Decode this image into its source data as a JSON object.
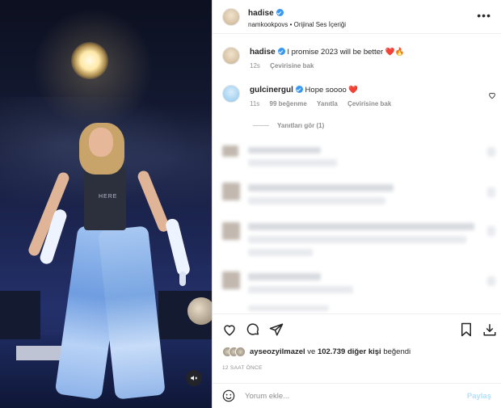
{
  "post": {
    "author": "hadise",
    "subtitle": "namkookpovs • Orijinal Ses İçeriği",
    "more_label": "•••"
  },
  "caption": {
    "author": "hadise",
    "text": "I promise 2023 will be better",
    "emoji": "❤️🔥",
    "time": "12s",
    "translate": "Çevirisine bak"
  },
  "top_comment": {
    "author": "gulcinergul",
    "text": "Hope soooo",
    "emoji": "❤️",
    "time": "11s",
    "likes": "99 beğenme",
    "reply": "Yanıtla",
    "translate": "Çevirisine bak"
  },
  "view_replies": "Yanıtları gör (1)",
  "likes": {
    "first_user": "ayseozyilmazel",
    "conjunction": "ve",
    "count": "102.739",
    "suffix_strong": "diğer kişi",
    "suffix": "beğendi"
  },
  "timestamp": "12 SAAT ÖNCE",
  "comment_box": {
    "placeholder": "Yorum ekle...",
    "post_label": "Paylaş"
  },
  "media": {
    "shirt_text": "HERE"
  },
  "icons": {
    "verified": "verified-badge-icon",
    "heart": "heart-icon",
    "comment": "comment-icon",
    "share": "share-icon",
    "save": "bookmark-icon",
    "download": "download-icon",
    "emoji": "emoji-icon",
    "mute": "muted-audio-icon"
  },
  "colors": {
    "verified": "#3897f0",
    "post_disabled": "#b2dffc"
  }
}
